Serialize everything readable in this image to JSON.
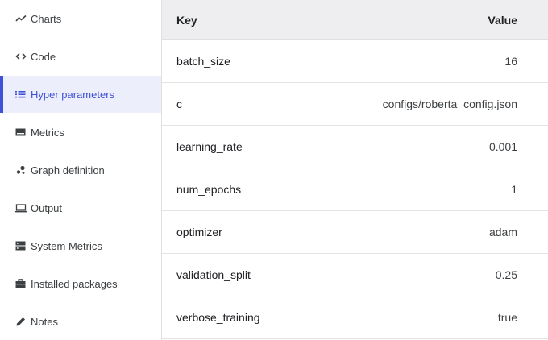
{
  "sidebar": {
    "items": [
      {
        "label": "Charts",
        "icon": "line-chart-icon"
      },
      {
        "label": "Code",
        "icon": "code-icon"
      },
      {
        "label": "Hyper parameters",
        "icon": "list-icon",
        "active": true
      },
      {
        "label": "Metrics",
        "icon": "metrics-icon"
      },
      {
        "label": "Graph definition",
        "icon": "graph-icon"
      },
      {
        "label": "Output",
        "icon": "monitor-icon"
      },
      {
        "label": "System Metrics",
        "icon": "server-icon"
      },
      {
        "label": "Installed packages",
        "icon": "briefcase-icon"
      },
      {
        "label": "Notes",
        "icon": "pencil-icon"
      }
    ]
  },
  "table": {
    "headers": {
      "key": "Key",
      "value": "Value"
    },
    "rows": [
      {
        "key": "batch_size",
        "value": "16"
      },
      {
        "key": "c",
        "value": "configs/roberta_config.json"
      },
      {
        "key": "learning_rate",
        "value": "0.001"
      },
      {
        "key": "num_epochs",
        "value": "1"
      },
      {
        "key": "optimizer",
        "value": "adam"
      },
      {
        "key": "validation_split",
        "value": "0.25"
      },
      {
        "key": "verbose_training",
        "value": "true"
      }
    ]
  },
  "colors": {
    "accent": "#3f51d6",
    "active_bg": "#eceefb",
    "header_bg": "#eeeef0"
  }
}
